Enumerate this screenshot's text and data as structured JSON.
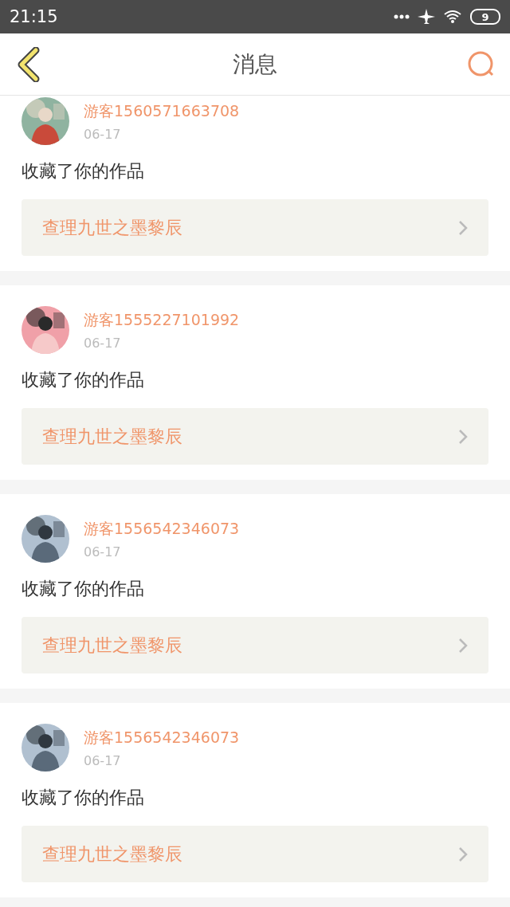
{
  "status_bar": {
    "time": "21:15",
    "battery": "9"
  },
  "header": {
    "title": "消息"
  },
  "messages": [
    {
      "user": "游客1560571663708",
      "date": "06-17",
      "action": "收藏了你的作品",
      "work": "查理九世之墨黎辰"
    },
    {
      "user": "游客1555227101992",
      "date": "06-17",
      "action": "收藏了你的作品",
      "work": "查理九世之墨黎辰"
    },
    {
      "user": "游客1556542346073",
      "date": "06-17",
      "action": "收藏了你的作品",
      "work": "查理九世之墨黎辰"
    },
    {
      "user": "游客1556542346073",
      "date": "06-17",
      "action": "收藏了你的作品",
      "work": "查理九世之墨黎辰"
    }
  ]
}
